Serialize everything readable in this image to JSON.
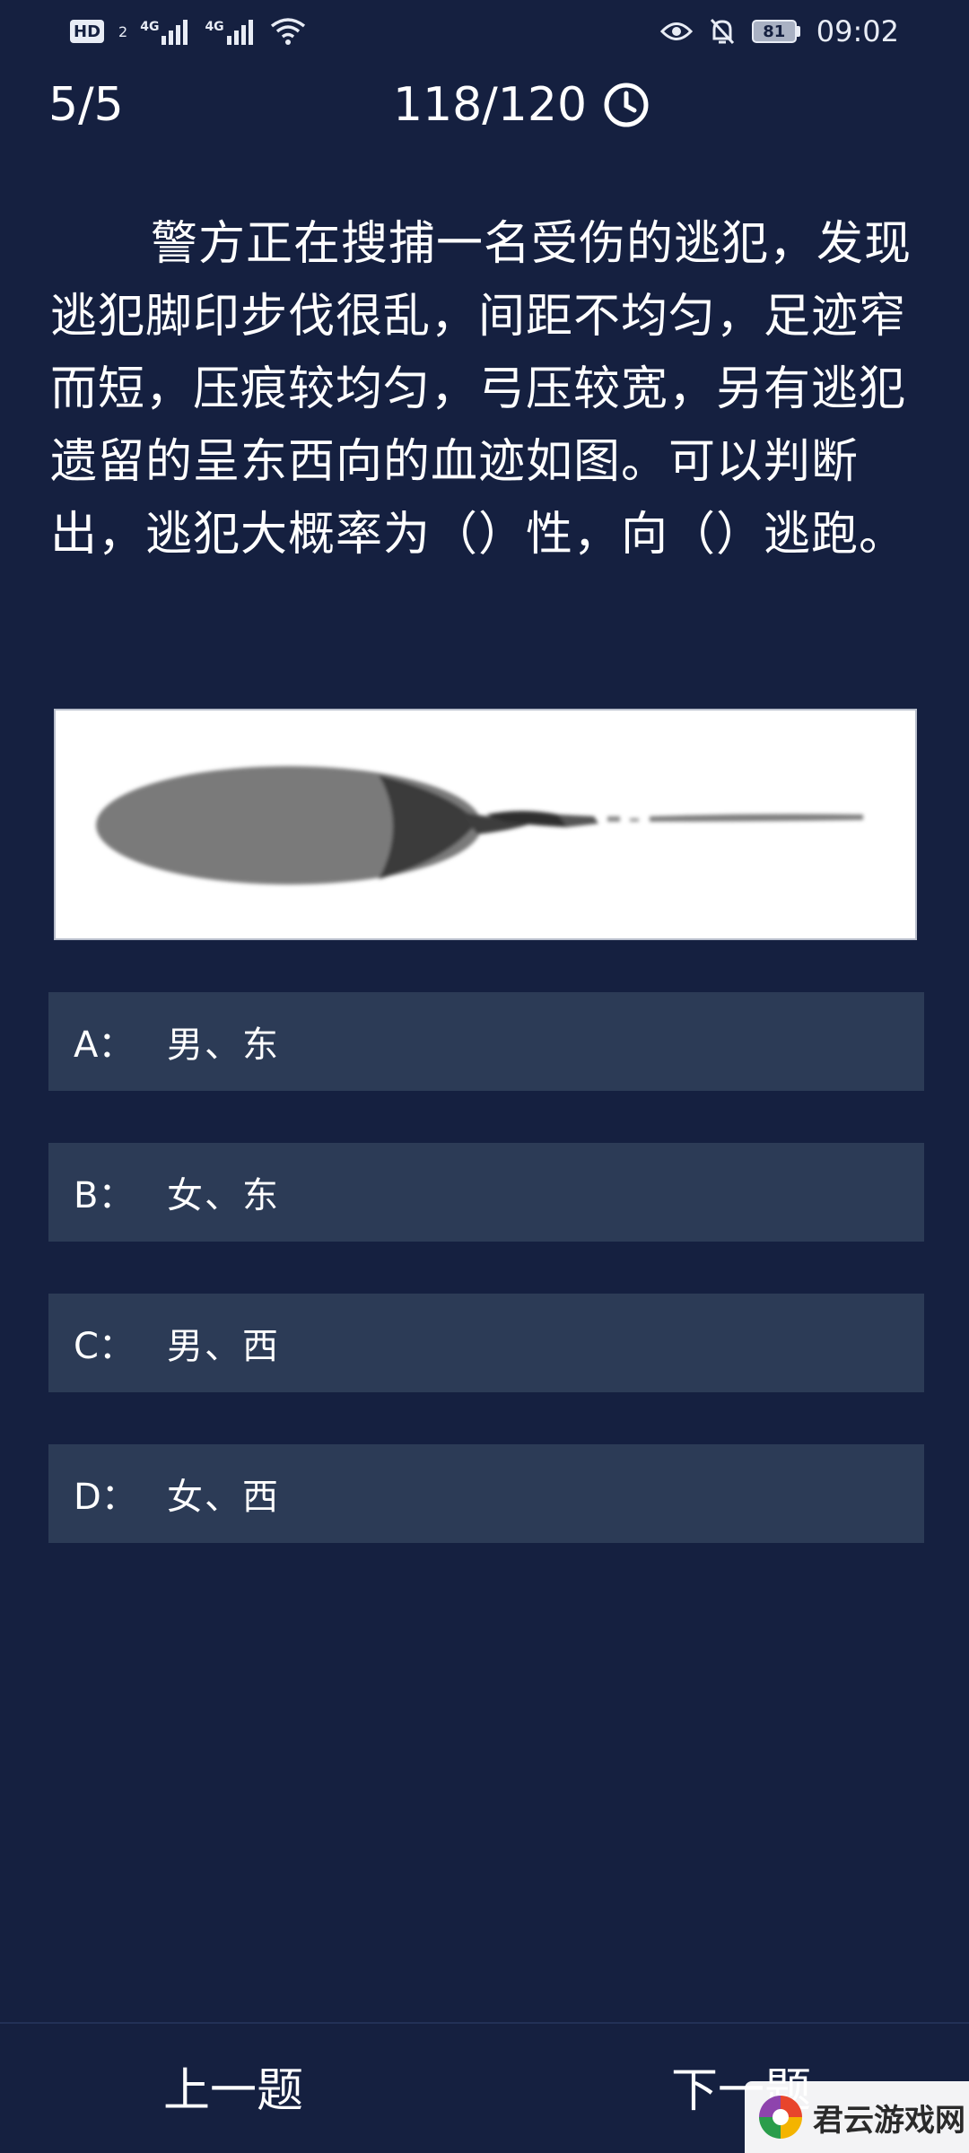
{
  "status_bar": {
    "hd_label": "HD",
    "hd_sub": "2",
    "net1": "4G",
    "net2": "4G",
    "battery": "81",
    "time": "09:02"
  },
  "header": {
    "progress": "5/5",
    "timer": "118/120"
  },
  "question": {
    "text": "警方正在搜捕一名受伤的逃犯，发现逃犯脚印步伐很乱，间距不均匀，足迹窄而短，压痕较均匀，弓压较宽，另有逃犯遗留的呈东西向的血迹如图。可以判断出，逃犯大概率为（）性，向（）逃跑。"
  },
  "options": [
    {
      "letter": "A：",
      "text": "男、东"
    },
    {
      "letter": "B：",
      "text": "女、东"
    },
    {
      "letter": "C：",
      "text": "男、西"
    },
    {
      "letter": "D：",
      "text": "女、西"
    }
  ],
  "nav": {
    "prev": "上一题",
    "next": "下一题"
  },
  "watermark": {
    "text": "君云游戏网"
  },
  "colors": {
    "background": "#152040",
    "option_bg": "#2c3b56",
    "text": "#ffffff"
  }
}
